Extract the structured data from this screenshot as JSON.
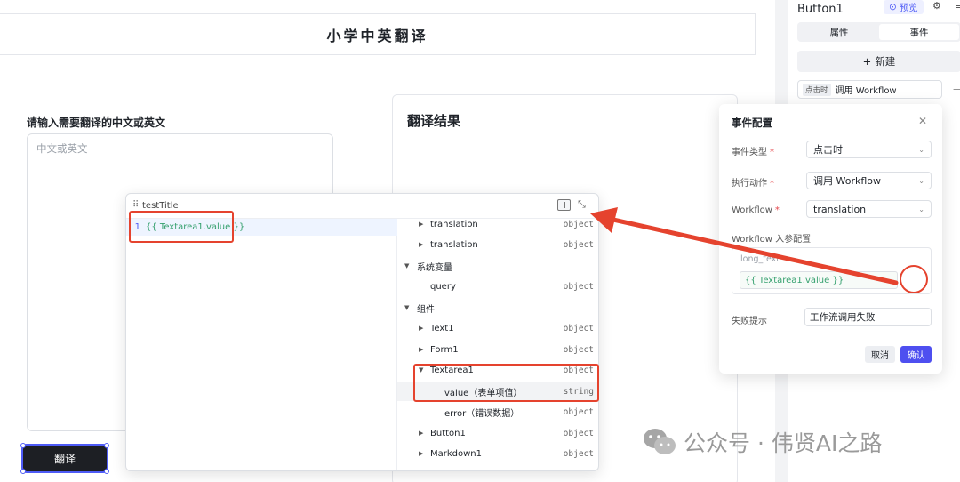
{
  "canvas": {
    "app_title": "小学中英翻译",
    "input_label": "请输入需要翻译的中文或英文",
    "textarea_placeholder": "中文或英文",
    "result_title": "翻译结果",
    "translate_button": "翻译"
  },
  "right_panel": {
    "component_name": "Button1",
    "preview_label": "预览",
    "tabs": [
      {
        "label": "属性",
        "active": false
      },
      {
        "label": "事件",
        "active": true
      }
    ],
    "new_label": "新建",
    "event_item": {
      "tag": "点击时",
      "action": "调用 Workflow"
    }
  },
  "event_config": {
    "title": "事件配置",
    "event_type_label": "事件类型",
    "event_type_value": "点击时",
    "action_label": "执行动作",
    "action_value": "调用 Workflow",
    "workflow_label": "Workflow",
    "workflow_value": "translation",
    "params_label": "Workflow 入参配置",
    "param_name": "long_text",
    "param_value": "{{ Textarea1.value }}",
    "fail_label": "失败提示",
    "fail_value": "工作流调用失败",
    "cancel_label": "取消",
    "confirm_label": "确认"
  },
  "expression_editor": {
    "name": "testTitle",
    "line_number": "1",
    "code_open": "{{ ",
    "code_body": "Textarea1.value",
    "code_close": " }}",
    "tree": [
      {
        "label": "translation",
        "type": "object"
      },
      {
        "label": "translation",
        "type": "object"
      },
      {
        "label": "系统变量",
        "type": ""
      },
      {
        "label": "query",
        "type": "object"
      },
      {
        "label": "组件",
        "type": ""
      },
      {
        "label": "Text1",
        "type": "object"
      },
      {
        "label": "Form1",
        "type": "object"
      },
      {
        "label": "Textarea1",
        "type": "object"
      },
      {
        "label": "value（表单项值）",
        "type": "string"
      },
      {
        "label": "error（错误数据）",
        "type": "object"
      },
      {
        "label": "Button1",
        "type": "object"
      },
      {
        "label": "Markdown1",
        "type": "object"
      }
    ]
  },
  "watermark": "公众号 · 伟贤AI之路",
  "colors": {
    "accent": "#4e4ff0",
    "annotation": "#e5432e",
    "expression": "#35a06e"
  }
}
